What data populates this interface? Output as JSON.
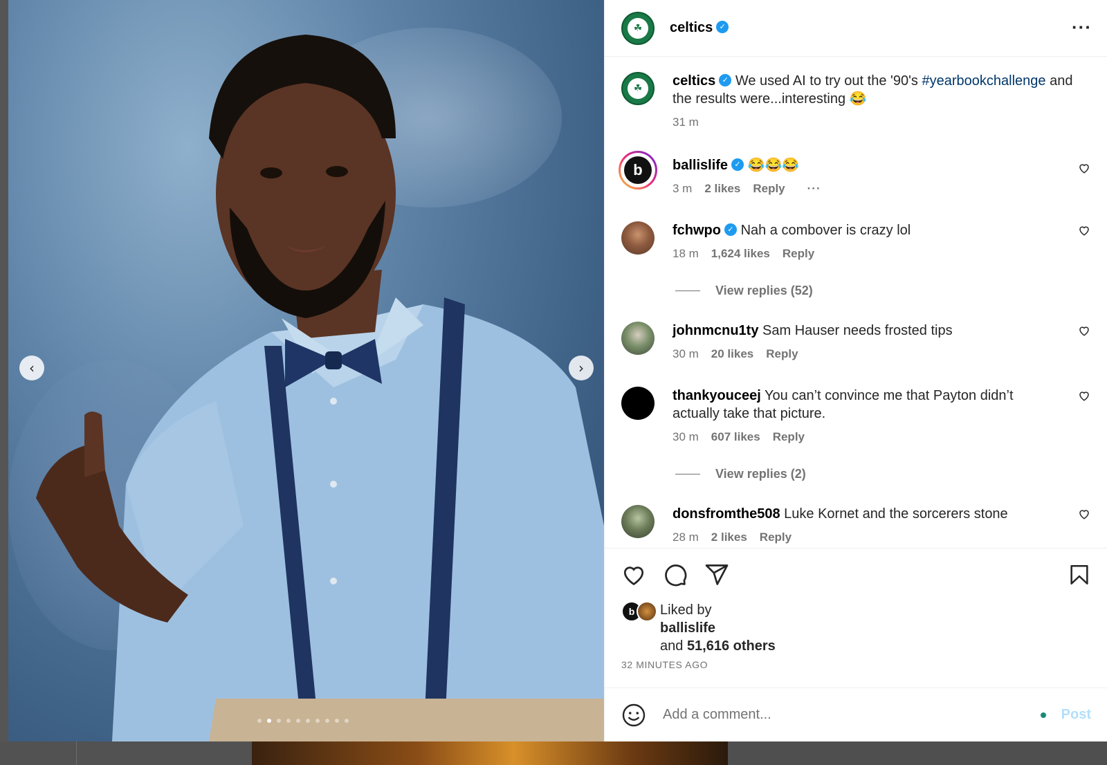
{
  "post": {
    "username": "celtics",
    "verified": true
  },
  "caption": {
    "username": "celtics",
    "text": "We used AI to try out the '90's",
    "hashtag": "#yearbookchallenge",
    "text2": "and the results were...interesting 😂",
    "time": "31 m"
  },
  "comments": [
    {
      "username": "ballislife",
      "verified": true,
      "text": "😂😂😂",
      "time": "3 m",
      "likes": "2 likes",
      "reply": "Reply",
      "avatar_text": "b"
    },
    {
      "username": "fchwpo",
      "verified": true,
      "text": "Nah a combover is crazy lol",
      "time": "18 m",
      "likes": "1,624 likes",
      "reply": "Reply",
      "view_replies": "View replies (52)"
    },
    {
      "username": "johnmcnu1ty",
      "verified": false,
      "text": "Sam Hauser needs frosted tips",
      "time": "30 m",
      "likes": "20 likes",
      "reply": "Reply"
    },
    {
      "username": "thankyouceej",
      "verified": false,
      "text": "You can’t convince me that Payton didn’t actually take that picture.",
      "time": "30 m",
      "likes": "607 likes",
      "reply": "Reply",
      "view_replies": "View replies (2)"
    },
    {
      "username": "donsfromthe508",
      "verified": false,
      "text": "Luke Kornet and the sorcerers stone",
      "time": "28 m",
      "likes": "2 likes",
      "reply": "Reply"
    }
  ],
  "liked": {
    "prefix": "Liked by",
    "user": "ballislife",
    "and": "and",
    "others": "51,616 others",
    "timestamp": "32 MINUTES AGO"
  },
  "comment_box": {
    "placeholder": "Add a comment...",
    "post_label": "Post"
  },
  "carousel": {
    "count": 10,
    "active": 1
  },
  "colors": {
    "verified": "#1e9bf0",
    "hashtag": "#00376b",
    "post_disabled": "#b2dffc",
    "meta": "#737373"
  },
  "icons": {
    "more": "more-horizontal-icon",
    "heart": "heart-icon",
    "comment": "comment-icon",
    "share": "share-icon",
    "bookmark": "bookmark-icon",
    "emoji": "emoji-icon",
    "prev": "chevron-left-icon",
    "next": "chevron-right-icon"
  }
}
